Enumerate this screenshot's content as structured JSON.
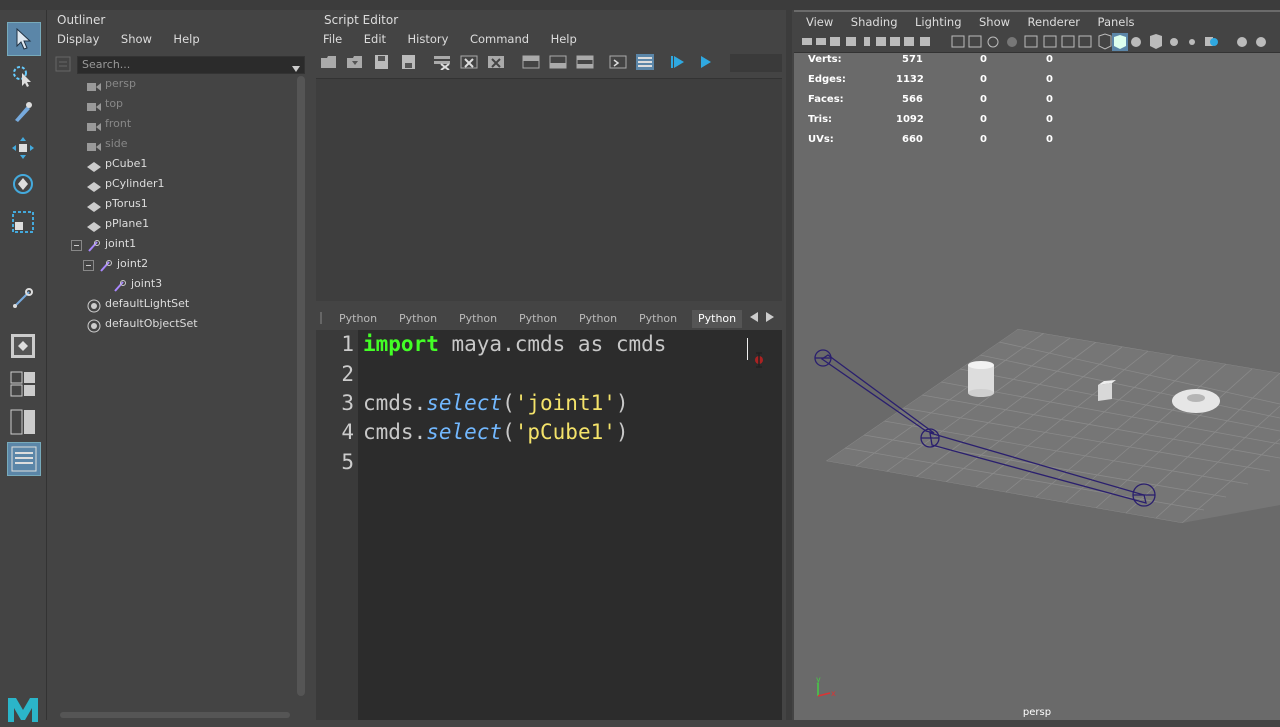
{
  "outliner": {
    "title": "Outliner",
    "menu": [
      "Display",
      "Show",
      "Help"
    ],
    "search_placeholder": "Search...",
    "items": [
      {
        "label": "persp",
        "type": "camera"
      },
      {
        "label": "top",
        "type": "camera"
      },
      {
        "label": "front",
        "type": "camera"
      },
      {
        "label": "side",
        "type": "camera"
      },
      {
        "label": "pCube1",
        "type": "mesh"
      },
      {
        "label": "pCylinder1",
        "type": "mesh"
      },
      {
        "label": "pTorus1",
        "type": "mesh"
      },
      {
        "label": "pPlane1",
        "type": "mesh"
      },
      {
        "label": "joint1",
        "type": "joint"
      },
      {
        "label": "joint2",
        "type": "joint"
      },
      {
        "label": "joint3",
        "type": "joint"
      },
      {
        "label": "defaultLightSet",
        "type": "set"
      },
      {
        "label": "defaultObjectSet",
        "type": "set"
      }
    ]
  },
  "script_editor": {
    "title": "Script Editor",
    "menu": [
      "File",
      "Edit",
      "History",
      "Command",
      "Help"
    ],
    "tabs": [
      "Python",
      "Python",
      "Python",
      "Python",
      "Python",
      "Python",
      "Python"
    ],
    "active_tab": 6,
    "line_numbers": [
      "1",
      "2",
      "3",
      "4",
      "5"
    ],
    "code": {
      "line1_kw": "import",
      "line1_rest": " maya.cmds as cmds",
      "line3_obj": "cmds.",
      "line3_fn": "select",
      "line3_open": "(",
      "line3_str": "'joint1'",
      "line3_close": ")",
      "line4_obj": "cmds.",
      "line4_fn": "select",
      "line4_open": "(",
      "line4_str": "'pCube1'",
      "line4_close": ")"
    }
  },
  "viewport": {
    "menu": [
      "View",
      "Shading",
      "Lighting",
      "Show",
      "Renderer",
      "Panels"
    ],
    "stats": [
      {
        "label": "Verts:",
        "v1": "571",
        "v2": "0",
        "v3": "0"
      },
      {
        "label": "Edges:",
        "v1": "1132",
        "v2": "0",
        "v3": "0"
      },
      {
        "label": "Faces:",
        "v1": "566",
        "v2": "0",
        "v3": "0"
      },
      {
        "label": "Tris:",
        "v1": "1092",
        "v2": "0",
        "v3": "0"
      },
      {
        "label": "UVs:",
        "v1": "660",
        "v2": "0",
        "v3": "0"
      }
    ],
    "camera_label": "persp",
    "axis_labels": {
      "y": "y",
      "x": "x"
    }
  },
  "colors": {
    "selection_accent": "#5b86a8",
    "keyword": "#43ff26",
    "function": "#72b8ff",
    "string": "#f4e36a"
  }
}
